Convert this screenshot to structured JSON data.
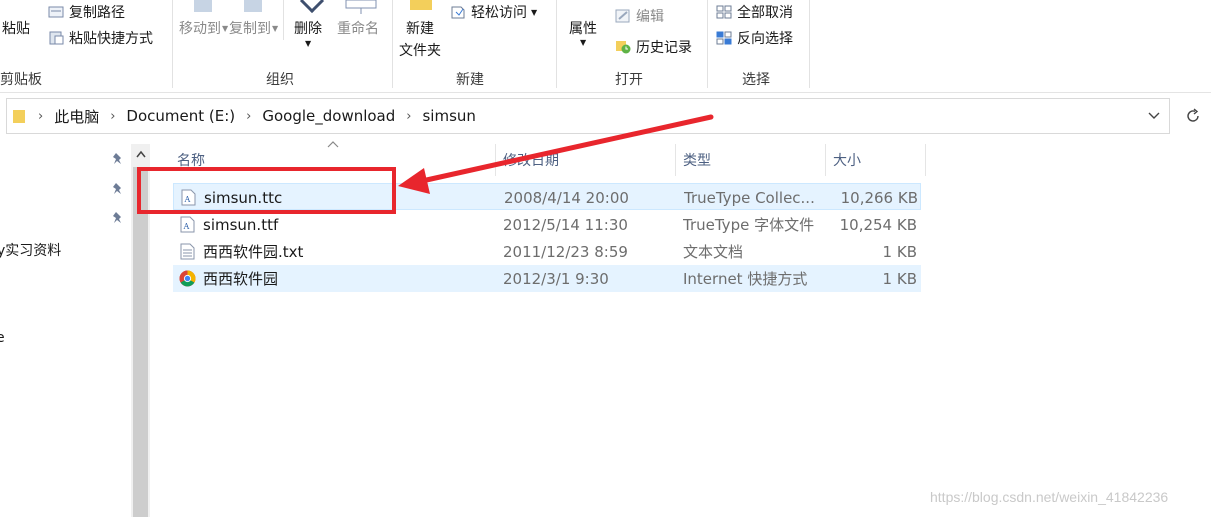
{
  "ribbon": {
    "clipboard": {
      "paste": "粘贴",
      "copy_path": "复制路径",
      "paste_shortcut": "粘贴快捷方式",
      "group_label": "剪贴板"
    },
    "organize": {
      "move_to": "移动到",
      "copy_to": "复制到",
      "delete": "删除",
      "rename": "重命名",
      "group_label": "组织"
    },
    "new": {
      "new_folder_line1": "新建",
      "new_folder_line2": "文件夹",
      "easy_access": "轻松访问",
      "group_label": "新建"
    },
    "open": {
      "properties": "属性",
      "edit": "编辑",
      "history": "历史记录",
      "group_label": "打开"
    },
    "select": {
      "select_none": "全部取消",
      "invert_selection": "反向选择",
      "group_label": "选择"
    }
  },
  "address": {
    "crumbs": [
      "此电脑",
      "Document (E:)",
      "Google_download",
      "simsun"
    ]
  },
  "nav": {
    "items": [
      "y实习资料",
      "e"
    ]
  },
  "columns": {
    "name": "名称",
    "date": "修改日期",
    "type": "类型",
    "size": "大小"
  },
  "files": [
    {
      "name": "simsun.ttc",
      "date": "2008/4/14 20:00",
      "type": "TrueType Collec...",
      "size": "10,266 KB"
    },
    {
      "name": "simsun.ttf",
      "date": "2012/5/14 11:30",
      "type": "TrueType 字体文件",
      "size": "10,254 KB"
    },
    {
      "name": "西西软件园.txt",
      "date": "2011/12/23 8:59",
      "type": "文本文档",
      "size": "1 KB"
    },
    {
      "name": "西西软件园",
      "date": "2012/3/1 9:30",
      "type": "Internet 快捷方式",
      "size": "1 KB"
    }
  ],
  "colors": {
    "annotation_red": "#e8262d",
    "selection_bg": "#e5f3ff",
    "header_text": "#4d6082"
  },
  "watermark": "https://blog.csdn.net/weixin_41842236"
}
